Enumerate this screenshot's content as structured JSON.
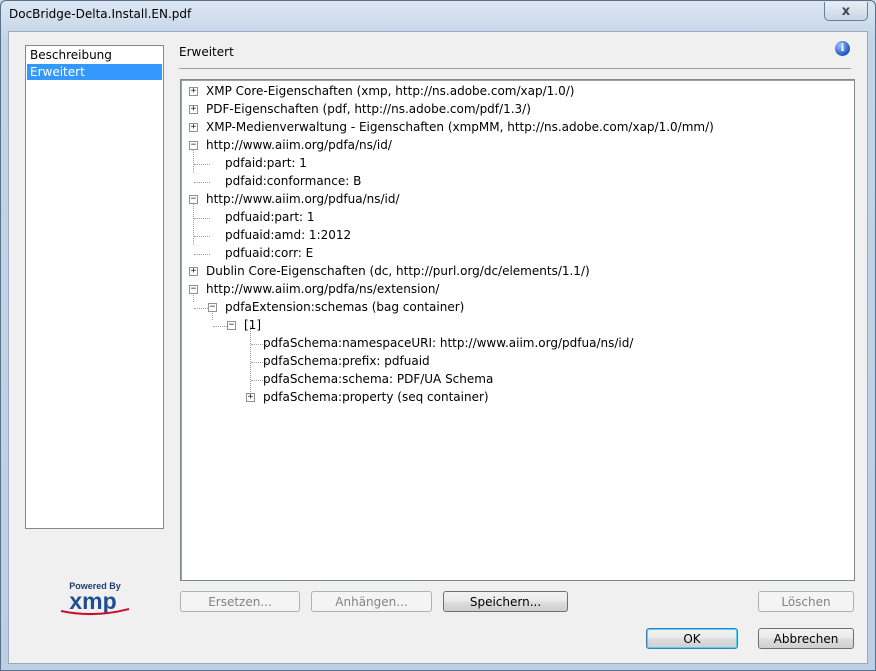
{
  "window": {
    "title": "DocBridge-Delta.Install.EN.pdf",
    "close_label": "x"
  },
  "nav": {
    "items": [
      {
        "label": "Beschreibung"
      },
      {
        "label": "Erweitert"
      }
    ]
  },
  "logo": {
    "powered_by": "Powered By",
    "brand": "xmp"
  },
  "section": {
    "title": "Erweitert"
  },
  "tree": {
    "rows": [
      {
        "label": "XMP Core-Eigenschaften (xmp, http://ns.adobe.com/xap/1.0/)"
      },
      {
        "label": "PDF-Eigenschaften (pdf, http://ns.adobe.com/pdf/1.3/)"
      },
      {
        "label": "XMP-Medienverwaltung - Eigenschaften (xmpMM, http://ns.adobe.com/xap/1.0/mm/)"
      },
      {
        "label": "http://www.aiim.org/pdfa/ns/id/"
      },
      {
        "label": "pdfaid:part: 1"
      },
      {
        "label": "pdfaid:conformance: B"
      },
      {
        "label": "http://www.aiim.org/pdfua/ns/id/"
      },
      {
        "label": "pdfuaid:part: 1"
      },
      {
        "label": "pdfuaid:amd: 1:2012"
      },
      {
        "label": "pdfuaid:corr: E"
      },
      {
        "label": "Dublin Core-Eigenschaften (dc, http://purl.org/dc/elements/1.1/)"
      },
      {
        "label": "http://www.aiim.org/pdfa/ns/extension/"
      },
      {
        "label": "pdfaExtension:schemas (bag container)"
      },
      {
        "label": "[1]"
      },
      {
        "label": "pdfaSchema:namespaceURI: http://www.aiim.org/pdfua/ns/id/"
      },
      {
        "label": "pdfaSchema:prefix: pdfuaid"
      },
      {
        "label": "pdfaSchema:schema: PDF/UA Schema"
      },
      {
        "label": "pdfaSchema:property (seq container)"
      }
    ]
  },
  "buttons": {
    "replace": "Ersetzen...",
    "append": "Anhängen...",
    "save": "Speichern...",
    "delete": "Löschen",
    "ok": "OK",
    "cancel": "Abbrechen"
  }
}
